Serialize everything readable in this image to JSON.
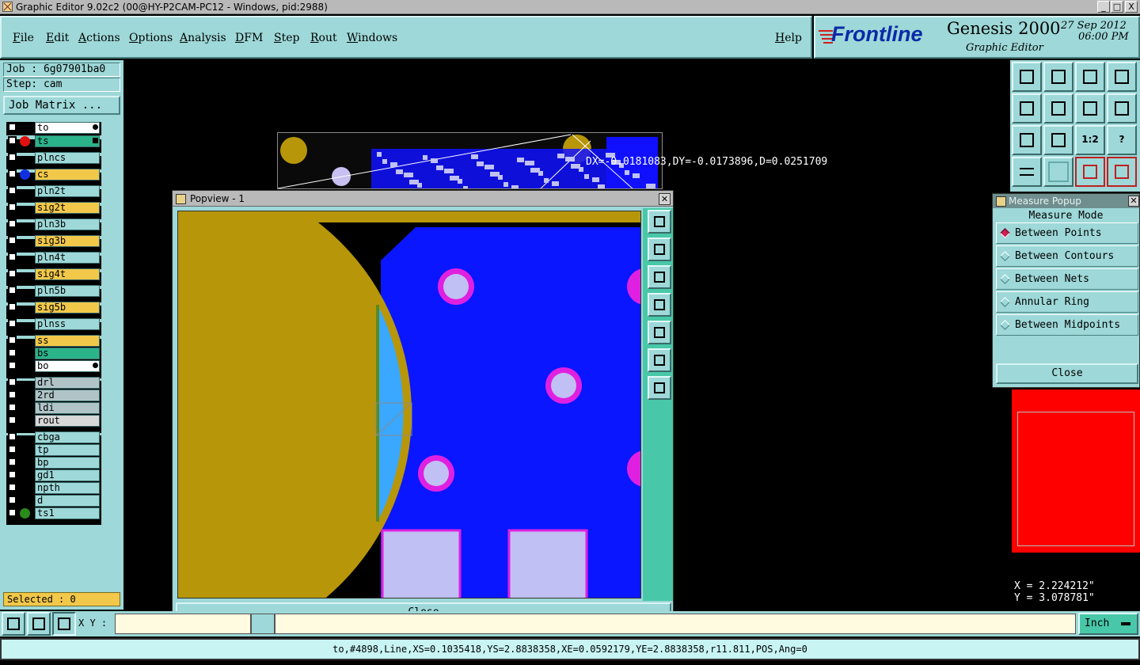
{
  "window": {
    "title": "Graphic Editor 9.02c2 (00@HY-P2CAM-PC12 - Windows, pid:2988)",
    "controls": [
      "_",
      "□",
      "X"
    ]
  },
  "menu": {
    "items": [
      "File",
      "Edit",
      "Actions",
      "Options",
      "Analysis",
      "DFM",
      "Step",
      "Rout",
      "Windows"
    ],
    "help": "Help"
  },
  "logo": {
    "brand": "Frontline",
    "product": "Genesis 2000",
    "subtitle": "Graphic Editor",
    "date": "27 Sep 2012",
    "time": "06:00 PM"
  },
  "job": {
    "job_label": "Job : 6g07901ba0",
    "step_label": "Step: cam",
    "matrix_button": "Job Matrix ..."
  },
  "layers": [
    {
      "name": "to",
      "color": "#ffffff",
      "mark": "",
      "flag": "edit"
    },
    {
      "name": "ts",
      "color": "#2bb38a",
      "mark": "#e01010",
      "flag": "grid"
    },
    {
      "name": "plncs",
      "color": "#9ed8d8",
      "mark": ""
    },
    {
      "name": "cs",
      "color": "#f2c84a",
      "mark": "#1030e0"
    },
    {
      "name": "pln2t",
      "color": "#9ed8d8",
      "mark": ""
    },
    {
      "name": "sig2t",
      "color": "#f2c84a",
      "mark": ""
    },
    {
      "name": "pln3b",
      "color": "#9ed8d8",
      "mark": ""
    },
    {
      "name": "sig3b",
      "color": "#f2c84a",
      "mark": ""
    },
    {
      "name": "pln4t",
      "color": "#9ed8d8",
      "mark": ""
    },
    {
      "name": "sig4t",
      "color": "#f2c84a",
      "mark": ""
    },
    {
      "name": "pln5b",
      "color": "#9ed8d8",
      "mark": ""
    },
    {
      "name": "sig5b",
      "color": "#f2c84a",
      "mark": ""
    },
    {
      "name": "plnss",
      "color": "#9ed8d8",
      "mark": ""
    },
    {
      "name": "ss",
      "color": "#f2c84a",
      "mark": ""
    },
    {
      "name": "bs",
      "color": "#2bb38a",
      "mark": ""
    },
    {
      "name": "bo",
      "color": "#ffffff",
      "mark": "",
      "flag": "edit"
    },
    {
      "name": "drl",
      "color": "#b0c4c8",
      "mark": ""
    },
    {
      "name": "2rd",
      "color": "#b0c4c8",
      "mark": ""
    },
    {
      "name": "ldi",
      "color": "#b0c4c8",
      "mark": ""
    },
    {
      "name": "rout",
      "color": "#d8d8d8",
      "mark": ""
    },
    {
      "name": "cbga",
      "color": "#9ed8d8",
      "mark": ""
    },
    {
      "name": "tp",
      "color": "#9ed8d8",
      "mark": ""
    },
    {
      "name": "bp",
      "color": "#9ed8d8",
      "mark": ""
    },
    {
      "name": "gd1",
      "color": "#9ed8d8",
      "mark": ""
    },
    {
      "name": "npth",
      "color": "#9ed8d8",
      "mark": ""
    },
    {
      "name": "d",
      "color": "#9ed8d8",
      "mark": ""
    },
    {
      "name": "ts1",
      "color": "#9ed8d8",
      "mark": "#2a8a1a"
    }
  ],
  "selected": "Selected : 0",
  "measure_readout": "DX=-0.0181083,DY=-0.0173896,D=0.0251709",
  "popview": {
    "title": "Popview - 1",
    "close": "Close"
  },
  "measure_popup": {
    "title": "Measure Popup",
    "mode_label": "Measure Mode",
    "options": [
      "Between Points",
      "Between Contours",
      "Between Nets",
      "Annular Ring",
      "Between Midpoints"
    ],
    "selected": "Between Points",
    "close": "Close"
  },
  "coords": {
    "x": "X = 2.224212\"",
    "y": "Y = 3.078781\""
  },
  "bottom": {
    "xy_label": "X Y :",
    "unit": "Inch"
  },
  "status": "to,#4898,Line,XS=0.1035418,YS=2.8838358,XE=0.0592179,YE=2.8838358,r11.811,POS,Ang=0",
  "tool_labels": {
    "ratio": "1:2",
    "help": "?"
  }
}
